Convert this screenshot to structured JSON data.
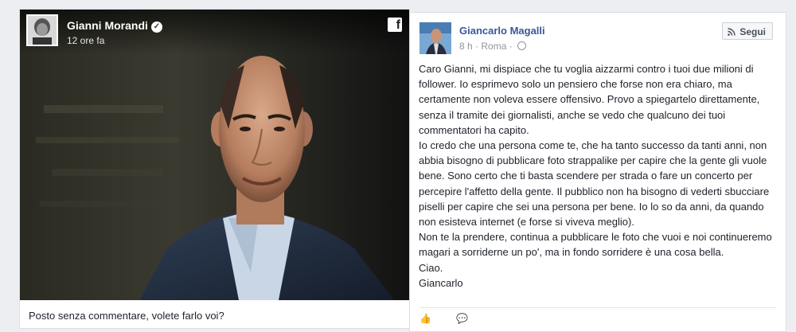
{
  "left_post": {
    "author": "Gianni Morandi",
    "timestamp": "12 ore fa",
    "verified_icon": "verified-check-icon",
    "brand_icon": "facebook-logo-icon",
    "brand_glyph": "f",
    "caption": "Posto senza commentare, volete farlo voi?"
  },
  "right_post": {
    "author": "Giancarlo Magalli",
    "time": "8 h",
    "separator": "·",
    "location": "Roma",
    "location_separator": "·",
    "follow_label": "Segui",
    "text": "Caro Gianni, mi dispiace che tu voglia aizzarmi contro i tuoi due milioni di follower. Io esprimevo solo un pensiero che forse non era chiaro, ma certamente non voleva essere offensivo. Provo a spiegartelo direttamente, senza il tramite dei giornalisti, anche se vedo che qualcuno dei tuoi commentatori ha capito.\nIo credo che una persona come te, che ha tanto successo da tanti anni, non abbia bisogno di pubblicare foto strappalike per capire che la gente gli vuole bene. Sono certo che ti basta scendere per strada o fare un concerto per percepire l'affetto della gente. Il pubblico non ha bisogno di vederti sbucciare piselli per capire che sei una persona per bene. Io lo so da anni, da quando non esisteva internet (e forse si viveva meglio).\nNon te la prendere, continua a pubblicare le foto che vuoi e noi continueremo magari a sorriderne un po', ma in fondo sorridere è una cosa bella.\nCiao.\nGiancarlo"
  },
  "colors": {
    "page_bg": "#eceef2",
    "link_blue": "#365899",
    "text_dark": "#1d2129",
    "meta_gray": "#90949c"
  }
}
